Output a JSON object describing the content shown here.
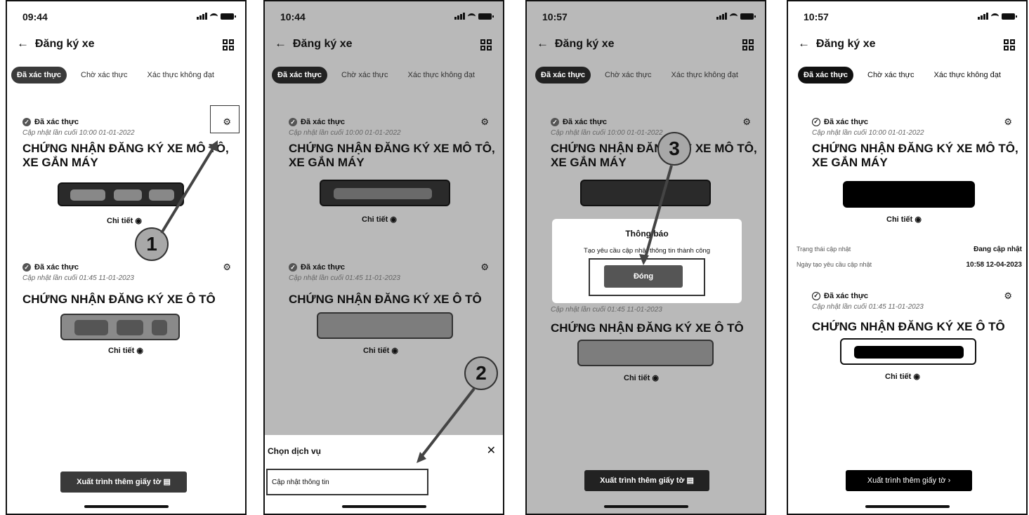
{
  "screens": [
    {
      "time": "09:44",
      "header_title": "Đăng ký xe",
      "tabs": [
        "Đã xác thực",
        "Chờ xác thực",
        "Xác thực không đạt"
      ],
      "cards": [
        {
          "status": "Đã xác thực",
          "updated": "Cập nhật lần cuối 10:00 01-01-2022",
          "title": "CHỨNG NHẬN ĐĂNG KÝ XE MÔ TÔ, XE GẮN MÁY",
          "detail": "Chi tiết"
        },
        {
          "status": "Đã xác thực",
          "updated": "Cập nhật lần cuối 01:45 11-01-2023",
          "title": "CHỨNG NHẬN ĐĂNG KÝ XE Ô TÔ",
          "detail": "Chi tiết"
        }
      ],
      "export_label": "Xuất trình thêm giấy tờ",
      "step": "1"
    },
    {
      "time": "10:44",
      "header_title": "Đăng ký xe",
      "tabs": [
        "Đã xác thực",
        "Chờ xác thực",
        "Xác thực không đạt"
      ],
      "cards": [
        {
          "status": "Đã xác thực",
          "updated": "Cập nhật lần cuối 10:00 01-01-2022",
          "title": "CHỨNG NHẬN ĐĂNG KÝ XE MÔ TÔ, XE GẮN MÁY",
          "detail": "Chi tiết"
        },
        {
          "status": "Đã xác thực",
          "updated": "Cập nhật lần cuối 01:45 11-01-2023",
          "title": "CHỨNG NHẬN ĐĂNG KÝ XE Ô TÔ",
          "detail": "Chi tiết"
        }
      ],
      "sheet_title": "Chọn dịch vụ",
      "sheet_item": "Cập nhật thông tin",
      "step": "2"
    },
    {
      "time": "10:57",
      "header_title": "Đăng ký xe",
      "tabs": [
        "Đã xác thực",
        "Chờ xác thực",
        "Xác thực không đạt"
      ],
      "cards": [
        {
          "status": "Đã xác thực",
          "updated": "Cập nhật lần cuối 10:00 01-01-2022",
          "title": "CHỨNG NHẬN ĐĂNG KÝ XE MÔ TÔ, XE GẮN MÁY",
          "detail": "Chi tiết"
        },
        {
          "status": "",
          "updated": "Cập nhật lần cuối 01:45 11-01-2023",
          "title": "CHỨNG NHẬN ĐĂNG KÝ XE Ô TÔ",
          "detail": "Chi tiết"
        }
      ],
      "modal_title": "Thông báo",
      "modal_text": "Tạo yêu cầu cập nhật thông tin thành công",
      "modal_button": "Đóng",
      "export_label": "Xuất trình thêm giấy tờ",
      "step": "3"
    },
    {
      "time": "10:57",
      "header_title": "Đăng ký xe",
      "tabs": [
        "Đã xác thực",
        "Chờ xác thực",
        "Xác thực không đạt"
      ],
      "cards": [
        {
          "status": "Đã xác thực",
          "updated": "Cập nhật lần cuối 10:00 01-01-2022",
          "title": "CHỨNG NHẬN ĐĂNG KÝ XE MÔ TÔ, XE GẮN MÁY",
          "detail": "Chi tiết"
        },
        {
          "status": "Đã xác thực",
          "updated": "Cập nhật lần cuối 01:45 11-01-2023",
          "title": "CHỨNG NHẬN ĐĂNG KÝ XE Ô TÔ",
          "detail": "Chi tiết"
        }
      ],
      "update_status_label": "Trạng thái cập nhật",
      "update_status_value": "Đang cập nhật",
      "request_date_label": "Ngày tạo yêu cầu cập nhật",
      "request_date_value": "10:58 12-04-2023",
      "export_label": "Xuất trình thêm giấy tờ"
    }
  ],
  "colors": {
    "dark": "#3a3a3a",
    "overlay": "#b9b9b9",
    "badge": "#a8a8a8"
  }
}
